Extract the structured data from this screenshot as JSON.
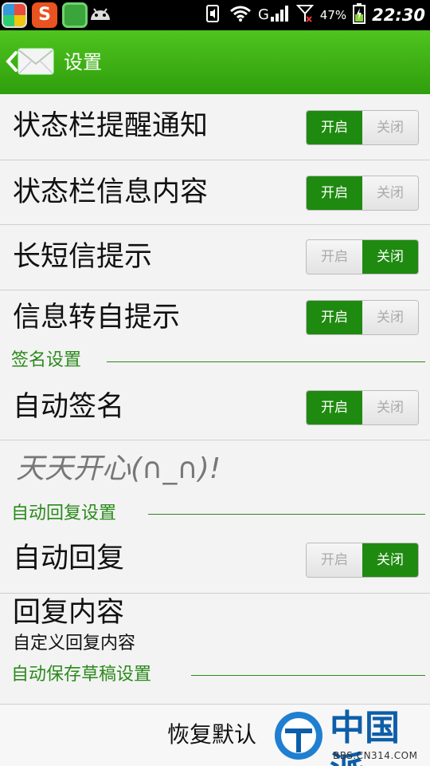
{
  "status_bar": {
    "battery": "47%",
    "time": "22:30",
    "icons": [
      "app-launcher-icon",
      "sogou-input-icon",
      "security-shield-icon",
      "android-icon",
      "mute-icon",
      "wifi-icon",
      "signal-icon",
      "signal-strength-icon",
      "battery-icon"
    ]
  },
  "title_bar": {
    "title": "设置",
    "icons": [
      "back-chevron-icon",
      "mail-icon"
    ]
  },
  "rows": [
    {
      "label": "状态栏提醒通知",
      "on_label": "开启",
      "off_label": "关闭",
      "state": "on"
    },
    {
      "label": "状态栏信息内容",
      "on_label": "开启",
      "off_label": "关闭",
      "state": "on"
    },
    {
      "label": "长短信提示",
      "on_label": "开启",
      "off_label": "关闭",
      "state": "off"
    },
    {
      "label": "信息转自提示",
      "on_label": "开启",
      "off_label": "关闭",
      "state": "on"
    }
  ],
  "signature_section": {
    "header": "签名设置",
    "auto_signature": {
      "label": "自动签名",
      "on_label": "开启",
      "off_label": "关闭",
      "state": "on"
    },
    "signature_text": "天天开心(∩_∩)!"
  },
  "auto_reply_section": {
    "header": "自动回复设置",
    "auto_reply": {
      "label": "自动回复",
      "on_label": "开启",
      "off_label": "关闭",
      "state": "off"
    },
    "reply_content": {
      "label": "回复内容",
      "sublabel": "自定义回复内容"
    }
  },
  "draft_section": {
    "header": "自动保存草稿设置"
  },
  "bottom": {
    "restore_label": "恢复默认",
    "watermark_text": "中国派",
    "watermark_url": "BBS.CN314.COM"
  },
  "colors": {
    "accent": "#1f8a10",
    "title_bar": "#2f9e0c",
    "section_header": "#2b8a1b"
  }
}
